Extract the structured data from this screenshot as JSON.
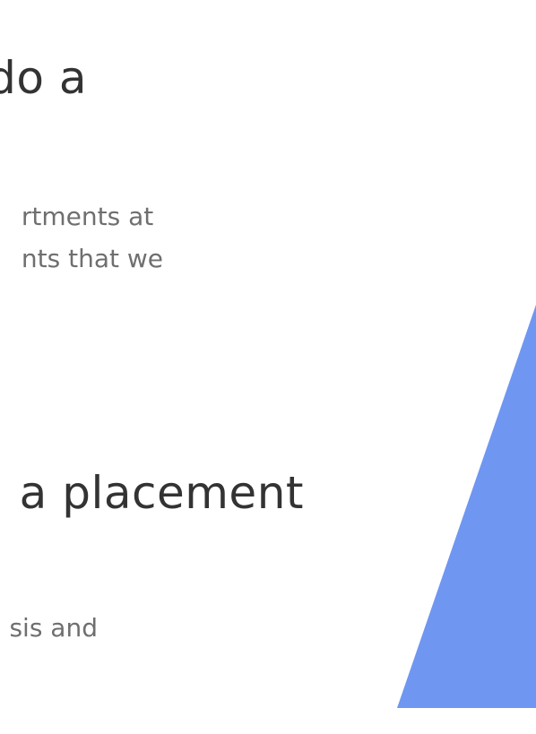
{
  "sections": [
    {
      "heading": "do a",
      "paragraph_lines": [
        "rtments at",
        "nts that we"
      ]
    },
    {
      "heading": "a placement",
      "paragraph_lines": [
        "sis and"
      ]
    }
  ],
  "decoration": {
    "triangle_color": "#6f96f1"
  }
}
